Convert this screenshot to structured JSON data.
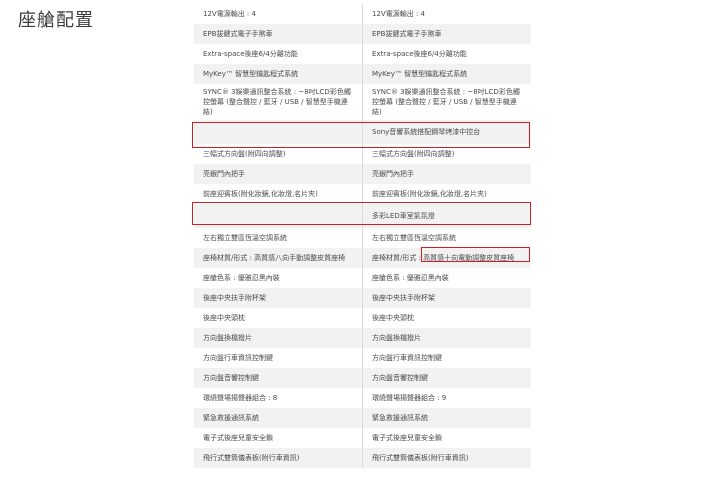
{
  "section_title": "座艙配置",
  "rows": [
    {
      "left": "12V電源輸出 : 4",
      "right": "12V電源輸出 : 4"
    },
    {
      "left": "EPB拔鍵式電子手煞車",
      "right": "EPB拔鍵式電子手煞車"
    },
    {
      "left": "Extra-space後座6/4分離功能",
      "right": "Extra-space後座6/4分離功能"
    },
    {
      "left": "MyKey™ 智慧型鑰匙程式系統",
      "right": "MyKey™ 智慧型鑰匙程式系統"
    },
    {
      "left": "SYNC® 3娛樂通訊整合系統 : ~8吋LCD彩色觸控螢幕 (整合聲控 / 藍牙 / USB / 智慧型手機連結)",
      "right": "SYNC® 3娛樂通訊整合系統 : ~8吋LCD彩色觸控螢幕 (整合聲控 / 藍牙 / USB / 智慧型手機連結)"
    },
    {
      "left": "",
      "right": "Sony音響系統搭配鋼琴烤漆中控台"
    },
    {
      "left": "三幅式方向盤(附四向調整)",
      "right": "三幅式方向盤(附四向調整)"
    },
    {
      "left": "亮銀門內把手",
      "right": "亮銀門內把手"
    },
    {
      "left": "前座迎賓板(附化妝鏡,化妝燈,名片夾)",
      "right": "前座迎賓板(附化妝鏡,化妝燈,名片夾)"
    },
    {
      "left": "",
      "right": "多彩LED車室氣氛燈"
    },
    {
      "left": "左右獨立雙區恆溫空調系統",
      "right": "左右獨立雙區恆溫空調系統"
    },
    {
      "left": "座椅材質/形式 : 高質感八向手動調整皮質座椅",
      "right": "座椅材質/形式 : 高質感十向電動調整皮質座椅"
    },
    {
      "left": "座艙色系 : 優雅忍黑內裝",
      "right": "座艙色系 : 優雅忍黑內裝"
    },
    {
      "left": "後座中央扶手附杯架",
      "right": "後座中央扶手附杯架"
    },
    {
      "left": "後座中央頭枕",
      "right": "後座中央頭枕"
    },
    {
      "left": "方向盤換檔撥片",
      "right": "方向盤換檔撥片"
    },
    {
      "left": "方向盤行車資訊控制鍵",
      "right": "方向盤行車資訊控制鍵"
    },
    {
      "left": "方向盤音響控制鍵",
      "right": "方向盤音響控制鍵"
    },
    {
      "left": "環繞聲場揚聲器組合 : 8",
      "right": "環繞聲場揚聲器組合 : 9"
    },
    {
      "left": "緊急救援通訊系統",
      "right": "緊急救援通訊系統"
    },
    {
      "left": "電子式後座兒童安全鎖",
      "right": "電子式後座兒童安全鎖"
    },
    {
      "left": "飛行式雙筒儀表板(附行車資訊)",
      "right": "飛行式雙筒儀表板(附行車資訊)"
    }
  ],
  "highlight_color": "#cc1f26",
  "stripe_color": "#f2f2f2"
}
